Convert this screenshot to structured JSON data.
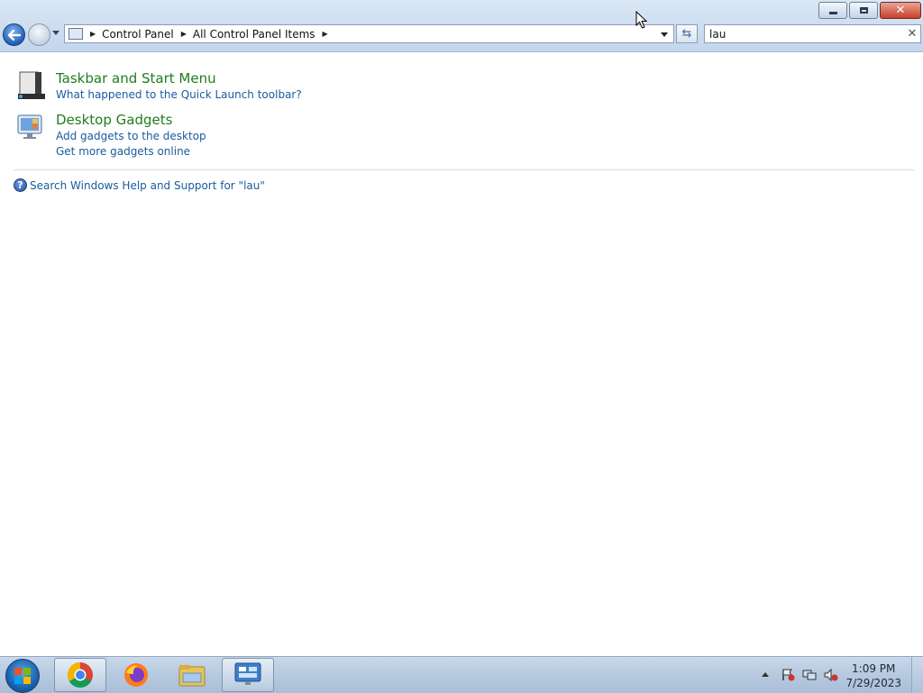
{
  "window": {
    "breadcrumb": [
      "Control Panel",
      "All Control Panel Items"
    ],
    "search_value": "lau"
  },
  "results": [
    {
      "title": "Taskbar and Start Menu",
      "links": [
        "What happened to the Quick Launch toolbar?"
      ]
    },
    {
      "title": "Desktop Gadgets",
      "links": [
        "Add gadgets to the desktop",
        "Get more gadgets online"
      ]
    }
  ],
  "help_link": "Search Windows Help and Support for \"lau\"",
  "taskbar": {
    "pinned": [
      "chrome-icon",
      "firefox-icon",
      "file-explorer-icon",
      "control-panel-icon"
    ],
    "clock_time": "1:09 PM",
    "clock_date": "7/29/2023"
  },
  "colors": {
    "result_title": "#1e7d1e",
    "link": "#1a5b9e"
  }
}
